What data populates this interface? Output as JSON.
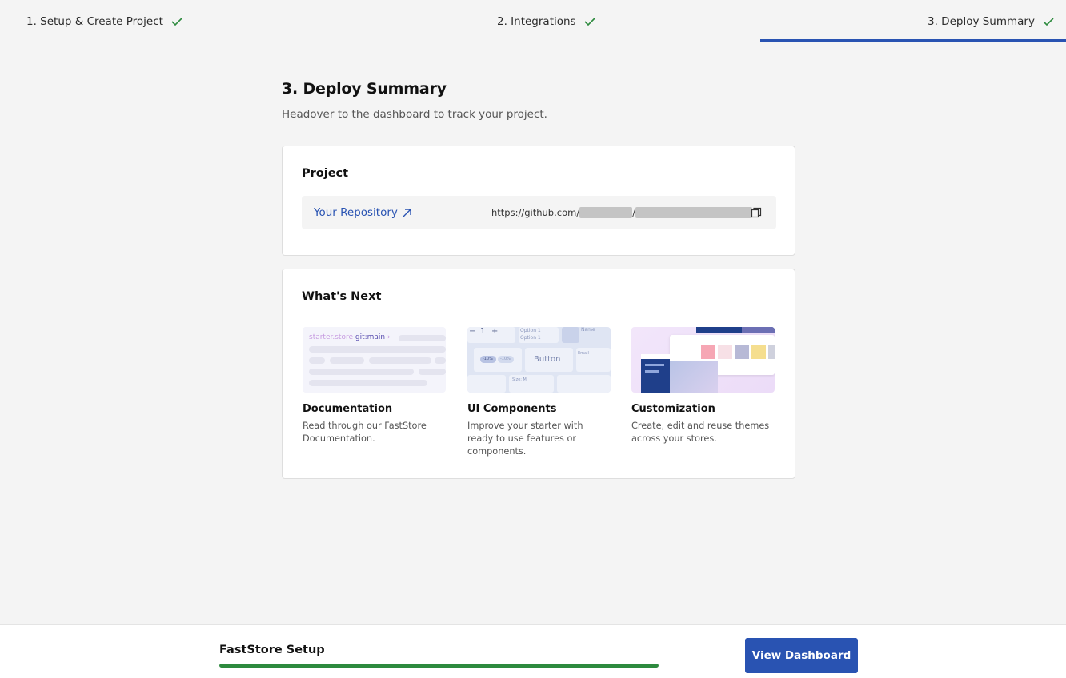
{
  "steps": [
    {
      "label": "1. Setup & Create Project",
      "complete": true
    },
    {
      "label": "2. Integrations",
      "complete": true
    },
    {
      "label": "3. Deploy Summary",
      "complete": true,
      "active": true
    }
  ],
  "header": {
    "title": "3. Deploy Summary",
    "subtitle": "Headover to the dashboard to track your project."
  },
  "project": {
    "title": "Project",
    "repo_link_label": "Your Repository",
    "repo_url_prefix": "https://github.com/",
    "repo_url_separator": "/"
  },
  "next": {
    "title": "What's Next",
    "tiles": [
      {
        "name": "Documentation",
        "desc": "Read through our FastStore Documentation."
      },
      {
        "name": "UI Components",
        "desc": "Improve your starter with ready to use features or components."
      },
      {
        "name": "Customization",
        "desc": "Create, edit and reuse themes across your stores."
      }
    ],
    "doc_thumb": {
      "brand": "starter.store",
      "branch": "git:main"
    },
    "ui_thumb": {
      "stepper_value": "1",
      "minus": "−",
      "plus": "+",
      "option1": "Option 1",
      "option2": "Option 1",
      "name_label": "Name",
      "button_label": "Button",
      "badge1": "-10%",
      "badge2": "-10%",
      "email_label": "Email",
      "size_label": "Size: M"
    }
  },
  "footer": {
    "title": "FastStore Setup",
    "progress": 1.0,
    "button_label": "View Dashboard"
  },
  "colors": {
    "accent": "#2953b2",
    "success": "#2d8a3e",
    "check": "#2d8a3e"
  }
}
